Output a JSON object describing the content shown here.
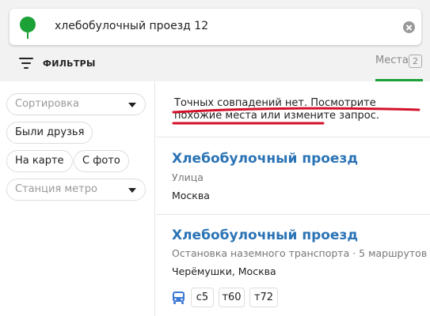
{
  "search": {
    "query": "хлебобулочный проезд 12"
  },
  "filters": {
    "label": "ФИЛЬТРЫ"
  },
  "tabs": {
    "places_label": "Места",
    "places_count": "2"
  },
  "sidebar": {
    "sort_placeholder": "Сортировка",
    "been_friends": "Были друзья",
    "on_map": "На карте",
    "with_photo": "С фото",
    "metro_placeholder": "Станция метро"
  },
  "notice": {
    "text": "Точных совпадений нет. Посмотрите похожие места или измените запрос."
  },
  "results": [
    {
      "title": "Хлебобулочный проезд",
      "type": "Улица",
      "city": "Москва"
    },
    {
      "title": "Хлебобулочный проезд",
      "type": "Остановка наземного транспорта · 5 маршрутов",
      "city": "Черёмушки, Москва",
      "routes": [
        "с5",
        "т60",
        "т72"
      ]
    }
  ],
  "colors": {
    "brand_green": "#1ba136",
    "link_blue": "#2a73b5",
    "annotation_red": "#d4102a",
    "bus_blue": "#3d7ad6"
  }
}
